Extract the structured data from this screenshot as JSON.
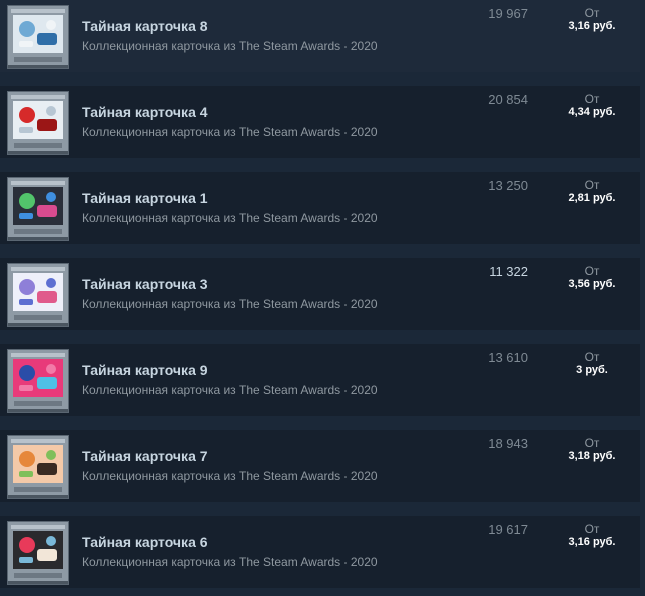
{
  "listings": [
    {
      "title": "Тайная карточка 8",
      "game": "Коллекционная карточка из The Steam Awards - 2020",
      "quantity": "19 967",
      "price_prefix": "От",
      "price": "3,16 руб.",
      "art_colors": [
        "#dfe8ef",
        "#6fa9d4",
        "#2f6ea8",
        "#f0f4f7"
      ],
      "icon": "ice-scene-card-art"
    },
    {
      "title": "Тайная карточка 4",
      "game": "Коллекционная карточка из The Steam Awards - 2020",
      "quantity": "20 854",
      "price_prefix": "От",
      "price": "4,34 руб.",
      "art_colors": [
        "#e8eef3",
        "#d62a2a",
        "#9b1616",
        "#b7c6d3"
      ],
      "icon": "red-vehicle-card-art"
    },
    {
      "title": "Тайная карточка 1",
      "game": "Коллекционная карточка из The Steam Awards - 2020",
      "quantity": "13 250",
      "price_prefix": "От",
      "price": "2,81 руб.",
      "art_colors": [
        "#2a2f3a",
        "#52c46b",
        "#d94b8f",
        "#3f8fe0"
      ],
      "icon": "faces-grid-card-art"
    },
    {
      "title": "Тайная карточка 3",
      "game": "Коллекционная карточка из The Steam Awards - 2020",
      "quantity": "11 322",
      "price_prefix": "От",
      "price": "3,56 руб.",
      "art_colors": [
        "#eef0fa",
        "#8e7fd8",
        "#e05a8c",
        "#5d6fd1"
      ],
      "icon": "pattern-card-art"
    },
    {
      "title": "Тайная карточка 9",
      "game": "Коллекционная карточка из The Steam Awards - 2020",
      "quantity": "13 610",
      "price_prefix": "От",
      "price": "3 руб.",
      "art_colors": [
        "#e83a7a",
        "#2a4da8",
        "#4ec0e6",
        "#f27aa8"
      ],
      "icon": "snail-card-art"
    },
    {
      "title": "Тайная карточка 7",
      "game": "Коллекционная карточка из The Steam Awards - 2020",
      "quantity": "18 943",
      "price_prefix": "От",
      "price": "3,18 руб.",
      "art_colors": [
        "#f4c9a8",
        "#e6873a",
        "#3a2a22",
        "#7fbf5a"
      ],
      "icon": "veggie-card-art"
    },
    {
      "title": "Тайная карточка 6",
      "game": "Коллекционная карточка из The Steam Awards - 2020",
      "quantity": "19 617",
      "price_prefix": "От",
      "price": "3,16 руб.",
      "art_colors": [
        "#2a2a2e",
        "#e83a5a",
        "#f2e6d8",
        "#7ab8d8"
      ],
      "icon": "space-card-art"
    }
  ]
}
